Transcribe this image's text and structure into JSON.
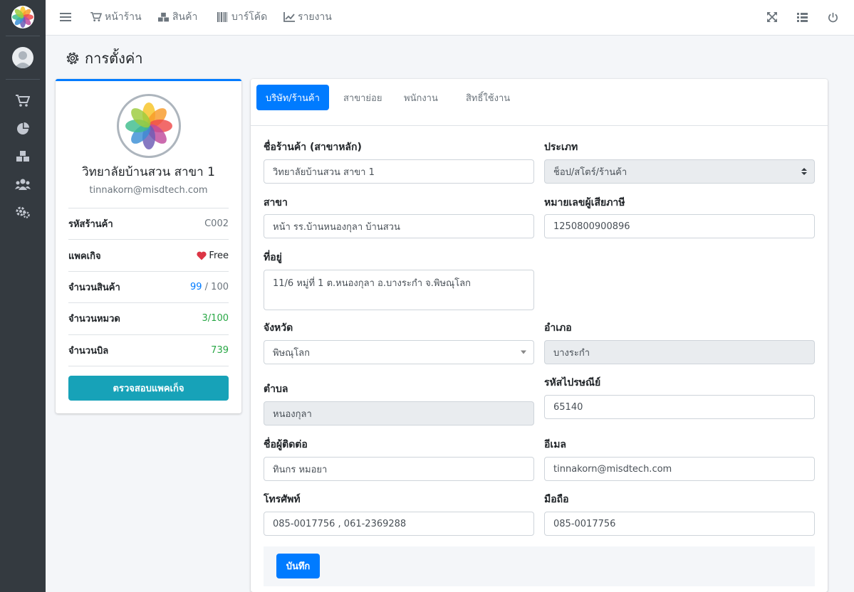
{
  "nav": {
    "storefront": "หน้าร้าน",
    "products": "สินค้า",
    "barcode": "บาร์โค้ด",
    "reports": "รายงาน"
  },
  "page": {
    "title": "การตั้งค่า"
  },
  "profile": {
    "name": "วิทยาลัยบ้านสวน สาขา 1",
    "email": "tinnakorn@misdtech.com",
    "rows": [
      {
        "label": "รหัสร้านค้า",
        "value": "C002"
      },
      {
        "label": "แพคเกิจ",
        "value": "Free"
      },
      {
        "label": "จำนวนสินค้า",
        "value_used": "99",
        "value_sep": " / ",
        "value_max": "100"
      },
      {
        "label": "จำนวนหมวด",
        "value": "3/100"
      },
      {
        "label": "จำนวนบิล",
        "value": "739"
      }
    ],
    "check_button": "ตรวจสอบแพคเก็จ"
  },
  "tabs": [
    "บริษัท/ร้านค้า",
    "สาขาย่อย",
    "พนักงาน",
    "สิทธิ์ใช้งาน"
  ],
  "form": {
    "shop_name": {
      "label": "ชื่อร้านค้า (สาขาหลัก)",
      "value": "วิทยาลัยบ้านสวน สาขา 1"
    },
    "type": {
      "label": "ประเภท",
      "value": "ช็อป/สโตร์/ร้านค้า"
    },
    "branch": {
      "label": "สาขา",
      "value": "หน้า รร.บ้านหนองกุลา บ้านสวน"
    },
    "tax_id": {
      "label": "หมายเลขผู้เสียภาษี",
      "value": "1250800900896"
    },
    "address": {
      "label": "ที่อยู่",
      "value": "11/6 หมู่ที่ 1 ต.หนองกุลา อ.บางระกำ จ.พิษณุโลก"
    },
    "province": {
      "label": "จังหวัด",
      "value": "พิษณุโลก"
    },
    "district": {
      "label": "อำเภอ",
      "value": "บางระกำ"
    },
    "subdistrict": {
      "label": "ตำบล",
      "value": "หนองกุลา"
    },
    "postcode": {
      "label": "รหัสไปรษณีย์",
      "value": "65140"
    },
    "contact": {
      "label": "ชื่อผู้ติดต่อ",
      "value": "ทินกร หมอยา"
    },
    "email": {
      "label": "อีเมล",
      "value": "tinnakorn@misdtech.com"
    },
    "phone": {
      "label": "โทรศัพท์",
      "value": "085-0017756 , 061-2369288"
    },
    "mobile": {
      "label": "มือถือ",
      "value": "085-0017756"
    }
  },
  "save_button": "บันทึก",
  "colors": {
    "primary": "#007bff",
    "info": "#17a2b8",
    "success": "#28a745",
    "sidebar": "#343a40",
    "heart": "#dc3545"
  },
  "icons": [
    "menu-icon",
    "cart-icon",
    "cubes-icon",
    "barcode-icon",
    "chart-line-icon",
    "expand-icon",
    "list-icon",
    "power-icon",
    "gear-icon",
    "pie-chart-icon",
    "users-icon",
    "cogs-icon",
    "heart-icon",
    "flower-logo-icon",
    "user-avatar-icon"
  ]
}
